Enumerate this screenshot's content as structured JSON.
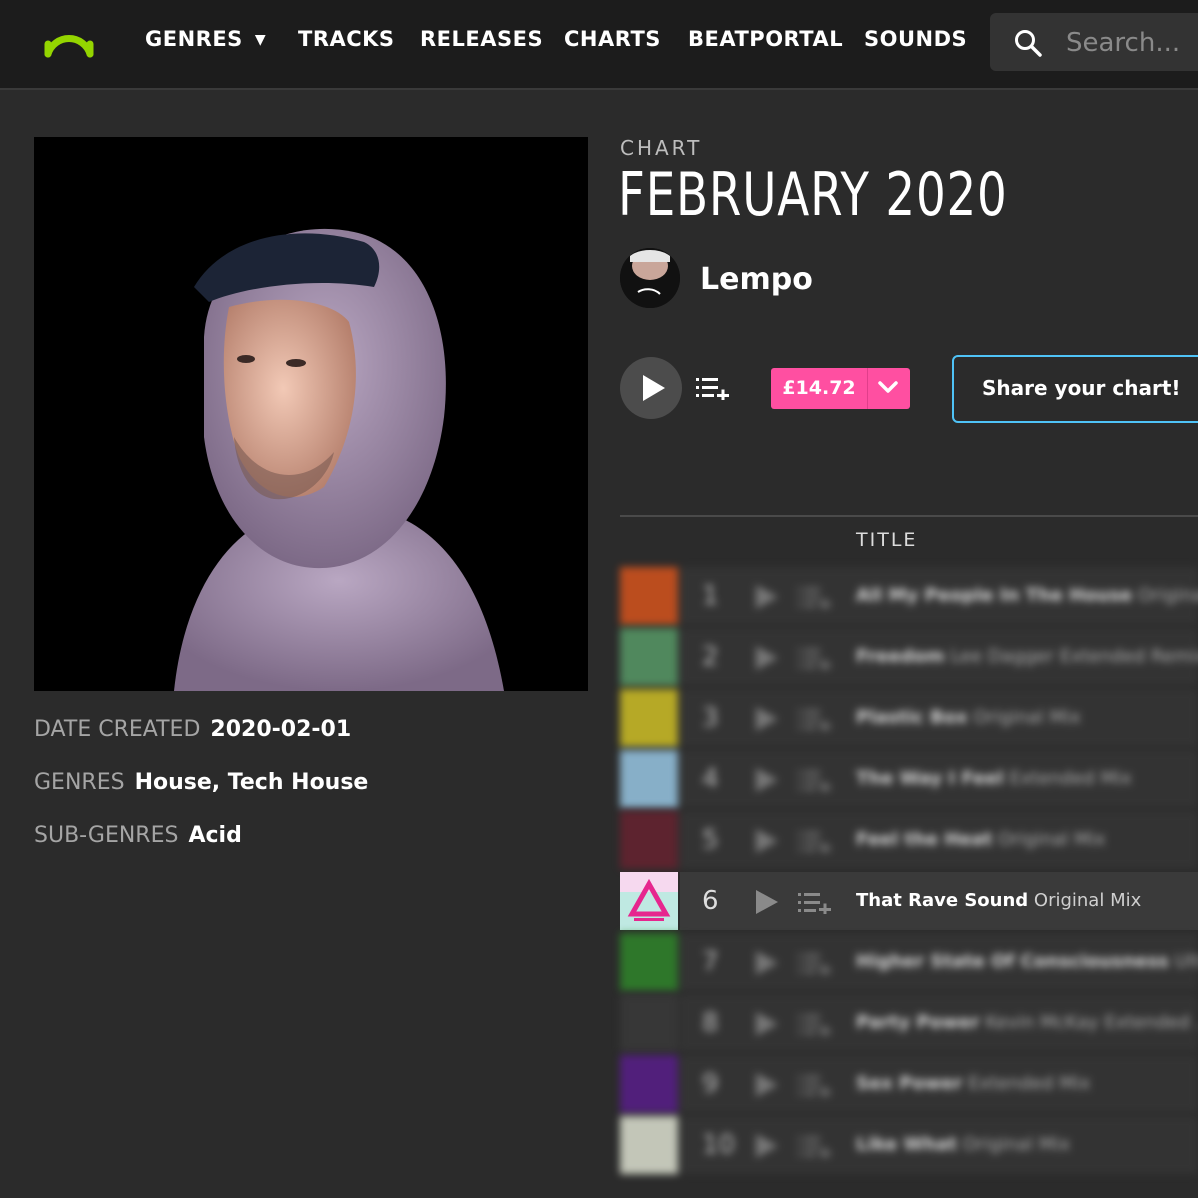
{
  "nav": {
    "items": [
      {
        "label": "GENRES",
        "dropdown": true
      },
      {
        "label": "TRACKS"
      },
      {
        "label": "RELEASES"
      },
      {
        "label": "CHARTS"
      },
      {
        "label": "BEATPORTAL"
      },
      {
        "label": "SOUNDS"
      }
    ],
    "search_placeholder": "Search...",
    "logo_color": "#94d500"
  },
  "chart": {
    "kicker": "CHART",
    "title": "FEBRUARY 2020",
    "artist": "Lempo",
    "price": "£14.72",
    "share_label": "Share your chart!",
    "accent_pink": "#ff4fa1",
    "accent_blue": "#4fc3f7"
  },
  "meta": {
    "date_label": "DATE CREATED",
    "date_value": "2020-02-01",
    "genres_label": "GENRES",
    "genres_value": "House, Tech House",
    "subgenres_label": "SUB-GENRES",
    "subgenres_value": "Acid"
  },
  "tracklist": {
    "column_title": "TITLE",
    "tracks": [
      {
        "num": "1",
        "name": "All My People In The House",
        "mix": "Original ...",
        "thumb_color": "#e0561c",
        "blurred": true
      },
      {
        "num": "2",
        "name": "Freedom",
        "mix": "Lee Dagger Extended Remix",
        "thumb_color": "#5aa06a",
        "blurred": true
      },
      {
        "num": "3",
        "name": "Plastic Box",
        "mix": "Original Mix",
        "thumb_color": "#d9c925",
        "blurred": true
      },
      {
        "num": "4",
        "name": "The Way I Feel",
        "mix": "Extended Mix",
        "thumb_color": "#9fd1f0",
        "blurred": true
      },
      {
        "num": "5",
        "name": "Feel the Heat",
        "mix": "Original Mix",
        "thumb_color": "#6a2230",
        "blurred": true
      },
      {
        "num": "6",
        "name": "That Rave Sound",
        "mix": "Original Mix",
        "thumb_color": "#c7e8ef",
        "blurred": false
      },
      {
        "num": "7",
        "name": "Higher State Of Consciousness",
        "mix": "Ultra ...",
        "thumb_color": "#2f8a2a",
        "blurred": true
      },
      {
        "num": "8",
        "name": "Party Power",
        "mix": "Kevin McKay Extended ...",
        "thumb_color": "#3a3a3a",
        "blurred": true
      },
      {
        "num": "9",
        "name": "Sex Power",
        "mix": "Extended Mix",
        "thumb_color": "#5b1d8f",
        "blurred": true
      },
      {
        "num": "10",
        "name": "Like What",
        "mix": "Original Mix",
        "thumb_color": "#e9eddc",
        "blurred": true
      }
    ]
  }
}
